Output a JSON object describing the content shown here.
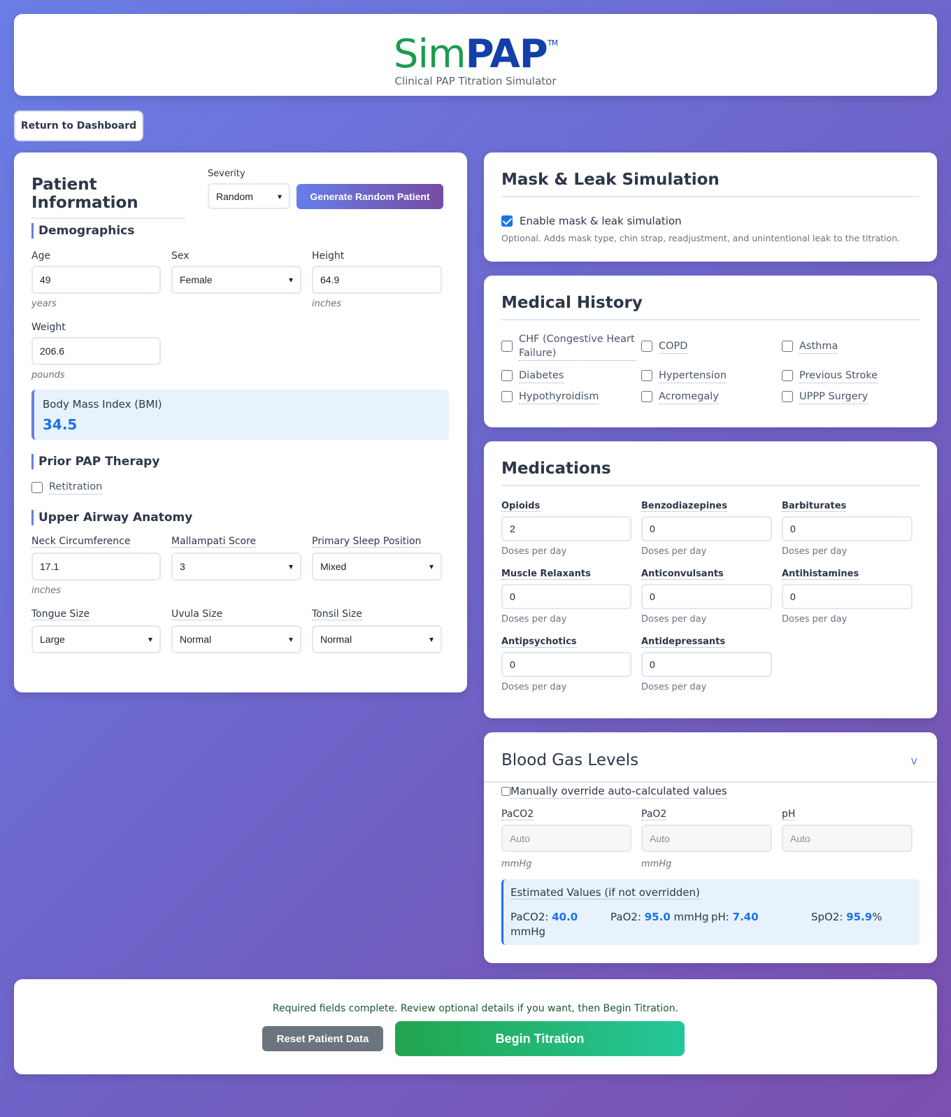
{
  "header": {
    "logo_sim": "Sim",
    "logo_pap": "PAP",
    "logo_tm": "TM",
    "subtitle": "Clinical PAP Titration Simulator"
  },
  "nav": {
    "return_label": "Return to Dashboard"
  },
  "patient": {
    "title": "Patient Information",
    "severity_label": "Severity",
    "severity_value": "Random",
    "generate_label": "Generate Random Patient",
    "demographics_heading": "Demographics",
    "age_label": "Age",
    "age_value": "49",
    "age_unit": "years",
    "sex_label": "Sex",
    "sex_value": "Female",
    "height_label": "Height",
    "height_value": "64.9",
    "height_unit": "inches",
    "weight_label": "Weight",
    "weight_value": "206.6",
    "weight_unit": "pounds",
    "bmi_label": "Body Mass Index (BMI)",
    "bmi_value": "34.5",
    "prior_pap_heading": "Prior PAP Therapy",
    "retitration_label": "Retitration",
    "airway_heading": "Upper Airway Anatomy",
    "neck_label": "Neck Circumference",
    "neck_value": "17.1",
    "neck_unit": "inches",
    "mallampati_label": "Mallampati Score",
    "mallampati_value": "3",
    "position_label": "Primary Sleep Position",
    "position_value": "Mixed",
    "tongue_label": "Tongue Size",
    "tongue_value": "Large",
    "uvula_label": "Uvula Size",
    "uvula_value": "Normal",
    "tonsil_label": "Tonsil Size",
    "tonsil_value": "Normal"
  },
  "mask": {
    "title": "Mask & Leak Simulation",
    "enable_label": "Enable mask & leak simulation",
    "enable_checked": true,
    "description": "Optional. Adds mask type, chin strap, readjustment, and unintentional leak to the titration."
  },
  "history": {
    "title": "Medical History",
    "items": [
      "CHF (Congestive Heart Failure)",
      "COPD",
      "Asthma",
      "Diabetes",
      "Hypertension",
      "Previous Stroke",
      "Hypothyroidism",
      "Acromegaly",
      "UPPP Surgery"
    ]
  },
  "medications": {
    "title": "Medications",
    "unit": "Doses per day",
    "items": [
      {
        "label": "Opioids",
        "value": "2"
      },
      {
        "label": "Benzodiazepines",
        "value": "0"
      },
      {
        "label": "Barbiturates",
        "value": "0"
      },
      {
        "label": "Muscle Relaxants",
        "value": "0"
      },
      {
        "label": "Anticonvulsants",
        "value": "0"
      },
      {
        "label": "Antihistamines",
        "value": "0"
      },
      {
        "label": "Antipsychotics",
        "value": "0"
      },
      {
        "label": "Antidepressants",
        "value": "0"
      }
    ]
  },
  "blood": {
    "title": "Blood Gas Levels",
    "collapse_glyph": "v",
    "override_label": "Manually override auto-calculated values",
    "paco2_label": "PaCO2",
    "pao2_label": "PaO2",
    "ph_label": "pH",
    "placeholder": "Auto",
    "unit_mmhg": "mmHg",
    "est_title": "Estimated Values (if not overridden)",
    "est_paco2_label": "PaCO2:",
    "est_paco2_value": "40.0",
    "est_paco2_unit": "mmHg",
    "est_pao2_label": "PaO2:",
    "est_pao2_value": "95.0",
    "est_pao2_unit": "mmHg",
    "est_ph_label": "pH:",
    "est_ph_value": "7.40",
    "est_spo2_label": "SpO2:",
    "est_spo2_value": "95.9",
    "est_spo2_unit": "%"
  },
  "footer": {
    "message": "Required fields complete. Review optional details if you want, then Begin Titration.",
    "reset_label": "Reset Patient Data",
    "begin_label": "Begin Titration"
  }
}
